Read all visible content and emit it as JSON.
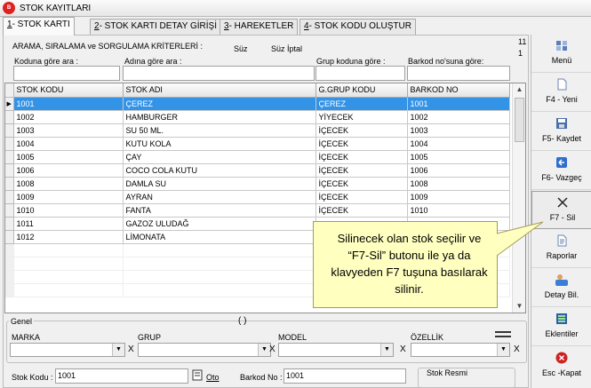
{
  "window": {
    "title": "STOK KAYITLARI",
    "icon_text": "Bilsoft"
  },
  "tabs": [
    {
      "key": "1",
      "rest": "- STOK KARTI"
    },
    {
      "key": "2",
      "rest": "- STOK KARTI DETAY GİRİŞİ"
    },
    {
      "key": "3",
      "rest": "- HAREKETLER"
    },
    {
      "key": "4",
      "rest": "- STOK KODU OLUŞTUR"
    }
  ],
  "criteria": {
    "title": "ARAMA, SIRALAMA ve SORGULAMA KRİTERLERİ :",
    "filter_label": "Süz",
    "filter_cancel_label": "Süz İptal",
    "counter_top": "11",
    "counter_bottom": "1",
    "fields": [
      {
        "label": "Koduna göre ara :",
        "value": ""
      },
      {
        "label": "Adına göre ara :",
        "value": ""
      },
      {
        "label": "Grup koduna göre :",
        "value": ""
      },
      {
        "label": "Barkod no'suna göre:",
        "value": ""
      }
    ]
  },
  "grid": {
    "columns": [
      "STOK KODU",
      "STOK ADI",
      "G.GRUP KODU",
      "BARKOD NO"
    ],
    "rows": [
      [
        "1001",
        "ÇEREZ",
        "ÇEREZ",
        "1001"
      ],
      [
        "1002",
        "HAMBURGER",
        "YİYECEK",
        "1002"
      ],
      [
        "1003",
        "SU 50 ML.",
        "İÇECEK",
        "1003"
      ],
      [
        "1004",
        "KUTU KOLA",
        "İÇECEK",
        "1004"
      ],
      [
        "1005",
        "ÇAY",
        "İÇECEK",
        "1005"
      ],
      [
        "1006",
        "COCO COLA KUTU",
        "İÇECEK",
        "1006"
      ],
      [
        "1008",
        "DAMLA SU",
        "İÇECEK",
        "1008"
      ],
      [
        "1009",
        "AYRAN",
        "İÇECEK",
        "1009"
      ],
      [
        "1010",
        "FANTA",
        "İÇECEK",
        "1010"
      ],
      [
        "1011",
        "GAZOZ ULUDAĞ",
        "",
        ""
      ],
      [
        "1012",
        "LİMONATA",
        "",
        ""
      ]
    ],
    "selected_row": 0,
    "row_indicator": "▶"
  },
  "sidebar": [
    {
      "label": "Menü",
      "icon": "menu-icon"
    },
    {
      "label": "F4 - Yeni",
      "icon": "new-document-icon"
    },
    {
      "label": "F5- Kaydet",
      "icon": "save-icon"
    },
    {
      "label": "F6- Vazgeç",
      "icon": "undo-icon"
    },
    {
      "label": "F7 - Sil",
      "icon": "delete-x-icon"
    },
    {
      "label": "Raporlar",
      "icon": "report-icon"
    },
    {
      "label": "Detay Bil.",
      "icon": "detail-info-icon"
    },
    {
      "label": "Eklentiler",
      "icon": "plugins-icon"
    },
    {
      "label": "Esc -Kapat",
      "icon": "close-red-icon"
    }
  ],
  "genel": {
    "title": "Genel",
    "fields": [
      {
        "label": "MARKA",
        "value": ""
      },
      {
        "label": "GRUP",
        "value": ""
      },
      {
        "label": "MODEL",
        "value": ""
      },
      {
        "label": "ÖZELLİK",
        "value": ""
      }
    ],
    "x_label": "X"
  },
  "bottom": {
    "stok_kodu_label": "Stok Kodu :",
    "stok_kodu_value": "1001",
    "oto_label": "Oto",
    "barkod_label": "Barkod No :",
    "barkod_value": "1001",
    "stok_resmi_label": "Stok Resmi"
  },
  "callout": {
    "text": "Silinecek olan stok seçilir ve “F7-Sil” butonu ile ya da klavyeden F7 tuşuna basılarak silinir."
  },
  "colors": {
    "selection": "#3393e6",
    "callout_bg": "#ffffc0",
    "delete_red": "#cc2222"
  }
}
